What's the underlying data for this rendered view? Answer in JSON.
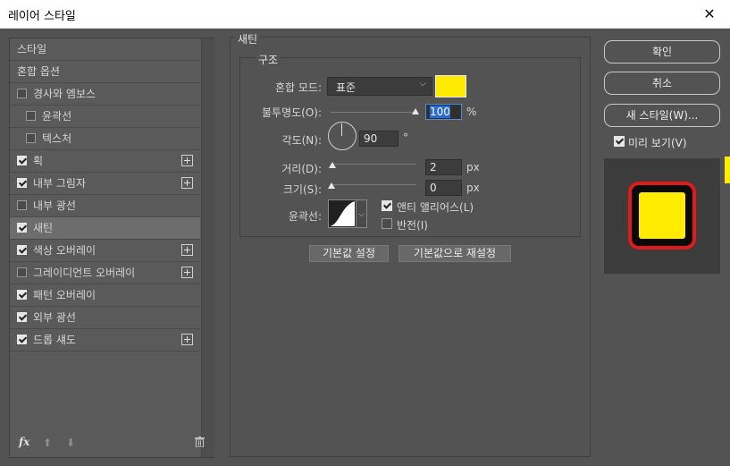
{
  "window": {
    "title": "레이어 스타일",
    "close_glyph": "✕"
  },
  "styles_list": [
    {
      "label": "스타일",
      "checkbox": false,
      "checked": false,
      "plus": false,
      "selected": false,
      "indent": 0
    },
    {
      "label": "혼합 옵션",
      "checkbox": false,
      "checked": false,
      "plus": false,
      "selected": false,
      "indent": 0
    },
    {
      "label": "경사와 엠보스",
      "checkbox": true,
      "checked": false,
      "plus": false,
      "selected": false,
      "indent": 0
    },
    {
      "label": "윤곽선",
      "checkbox": true,
      "checked": false,
      "plus": false,
      "selected": false,
      "indent": 1
    },
    {
      "label": "텍스처",
      "checkbox": true,
      "checked": false,
      "plus": false,
      "selected": false,
      "indent": 1
    },
    {
      "label": "획",
      "checkbox": true,
      "checked": true,
      "plus": true,
      "selected": false,
      "indent": 0
    },
    {
      "label": "내부 그림자",
      "checkbox": true,
      "checked": true,
      "plus": true,
      "selected": false,
      "indent": 0
    },
    {
      "label": "내부 광선",
      "checkbox": true,
      "checked": false,
      "plus": false,
      "selected": false,
      "indent": 0
    },
    {
      "label": "새틴",
      "checkbox": true,
      "checked": true,
      "plus": false,
      "selected": true,
      "indent": 0
    },
    {
      "label": "색상 오버레이",
      "checkbox": true,
      "checked": true,
      "plus": true,
      "selected": false,
      "indent": 0
    },
    {
      "label": "그레이디언트 오버레이",
      "checkbox": true,
      "checked": false,
      "plus": true,
      "selected": false,
      "indent": 0
    },
    {
      "label": "패턴 오버레이",
      "checkbox": true,
      "checked": true,
      "plus": false,
      "selected": false,
      "indent": 0
    },
    {
      "label": "외부 광선",
      "checkbox": true,
      "checked": true,
      "plus": false,
      "selected": false,
      "indent": 0
    },
    {
      "label": "드롭 섀도",
      "checkbox": true,
      "checked": true,
      "plus": true,
      "selected": false,
      "indent": 0
    }
  ],
  "bottom_bar": {
    "fx": "fx",
    "up": "⬆",
    "down": "⬇"
  },
  "satin": {
    "section_title": "새틴",
    "group_title": "구조",
    "blend_mode_label": "혼합 모드:",
    "blend_mode_value": "표준",
    "color": "#ffeb00",
    "opacity_label": "불투명도(O):",
    "opacity_value": "100",
    "opacity_unit": "%",
    "opacity_level": 1.0,
    "angle_label": "각도(N):",
    "angle_value": "90",
    "angle_unit": "°",
    "distance_label": "거리(D):",
    "distance_value": "2",
    "distance_unit": "px",
    "size_label": "크기(S):",
    "size_value": "0",
    "size_unit": "px",
    "contour_label": "윤곽선:",
    "antialias_label": "앤티 앨리어스(L)",
    "antialias_checked": true,
    "invert_label": "반전(I)",
    "invert_checked": false,
    "make_default": "기본값 설정",
    "reset_default": "기본값으로 재설정"
  },
  "buttons": {
    "ok": "확인",
    "cancel": "취소",
    "new_style": "새 스타일(W)...",
    "preview_label": "미리 보기(V)",
    "preview_checked": true
  },
  "preview_colors": {
    "fill": "#ffec00",
    "stroke": "#e01a1a"
  }
}
